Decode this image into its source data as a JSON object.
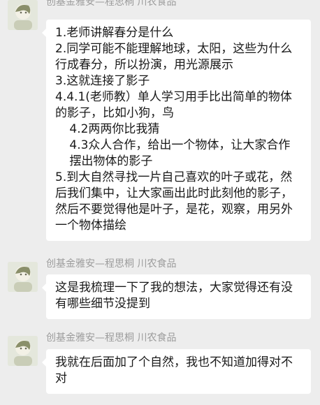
{
  "messages": [
    {
      "sender": "创基金雅安—程思桐 川农食品",
      "lines": [
        "1.老师讲解春分是什么",
        "2.同学可能不能理解地球，太阳，这些为什么行成春分，所以扮演，用光源展示",
        "3.这就连接了影子",
        "4.4.1(老师教）单人学习用手比出简单的物体的影子，比如小狗，鸟",
        "4.2两两你比我猜",
        "4.3众人合作，给出一个物体，让大家合作摆出物体的影子",
        "5.到大自然寻找一片自己喜欢的叶子或花，然后我们集中，让大家画出此时此刻他的影子，然后不要觉得他是叶子，是花，观察，用另外一个物体描绘"
      ]
    },
    {
      "sender": "创基金雅安—程思桐 川农食品",
      "text": "这是我梳理一下了我的想法，大家觉得还有没有哪些细节没提到"
    },
    {
      "sender": "创基金雅安—程思桐 川农食品",
      "text": "我就在后面加了个自然，我也不知道加得对不对"
    }
  ],
  "icons": {
    "avatar": "avatar-photo-icon"
  },
  "colors": {
    "background": "#ededed",
    "bubble": "#ffffff",
    "sender": "#9c9c9c",
    "text": "#191919"
  }
}
